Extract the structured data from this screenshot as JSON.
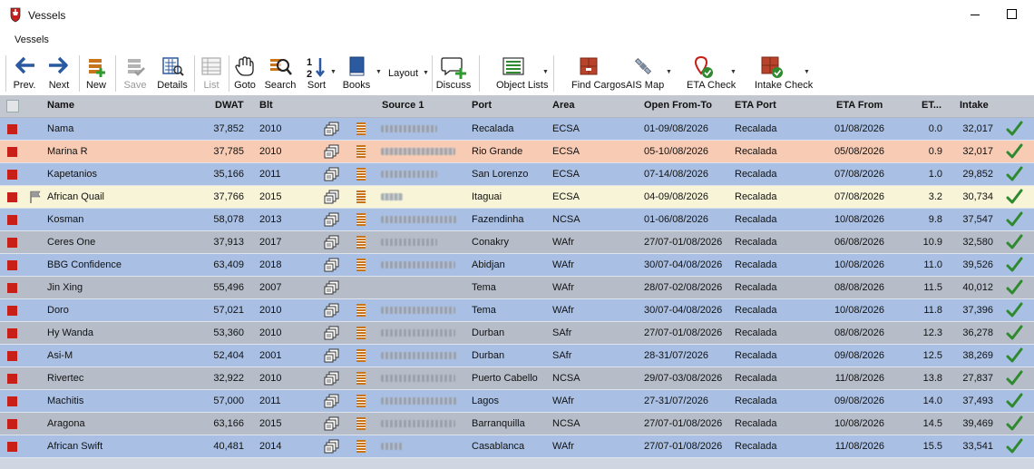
{
  "window": {
    "title": "Vessels"
  },
  "menu": {
    "vessels": "Vessels"
  },
  "toolbar": {
    "prev": "Prev.",
    "next": "Next",
    "new": "New",
    "save": "Save",
    "details": "Details",
    "list": "List",
    "goto": "Goto",
    "search": "Search",
    "sort": "Sort",
    "books": "Books",
    "layout": "Layout",
    "discuss": "Discuss",
    "object_lists": "Object Lists",
    "find_cargos": "Find Cargos",
    "ais_map": "AIS Map",
    "eta_check": "ETA Check",
    "intake_check": "Intake Check"
  },
  "columns": {
    "name": "Name",
    "dwat": "DWAT",
    "blt": "Blt",
    "source": "Source 1",
    "port": "Port",
    "area": "Area",
    "open": "Open From-To",
    "eta_port": "ETA Port",
    "eta_from": "ETA From",
    "et": "ET...",
    "intake": "Intake"
  },
  "colors": {
    "row_blue": "#a9c0e4",
    "row_grey": "#b6bdc9",
    "row_salmon": "#f7cbb4",
    "row_cream": "#f7f4d8",
    "status_red": "#c82018",
    "tick_green": "#2f8a2f",
    "book_orange": "#c8741c"
  },
  "rows": [
    {
      "name": "Nama",
      "dwat": "37,852",
      "blt": "2010",
      "port": "Recalada",
      "area": "ECSA",
      "open": "01-09/08/2026",
      "eta_port": "Recalada",
      "eta_from": "01/08/2026",
      "et": "0.0",
      "intake": "32,017",
      "bg": "#a9c0e4",
      "flag": false,
      "book": true,
      "src_w": 62
    },
    {
      "name": "Marina R",
      "dwat": "37,785",
      "blt": "2010",
      "port": "Rio Grande",
      "area": "ECSA",
      "open": "05-10/08/2026",
      "eta_port": "Recalada",
      "eta_from": "05/08/2026",
      "et": "0.9",
      "intake": "32,017",
      "bg": "#f7cbb4",
      "flag": false,
      "book": true,
      "src_w": 82
    },
    {
      "name": "Kapetanios",
      "dwat": "35,166",
      "blt": "2011",
      "port": "San Lorenzo",
      "area": "ECSA",
      "open": "07-14/08/2026",
      "eta_port": "Recalada",
      "eta_from": "07/08/2026",
      "et": "1.0",
      "intake": "29,852",
      "bg": "#a9c0e4",
      "flag": false,
      "book": true,
      "src_w": 62
    },
    {
      "name": "African Quail",
      "dwat": "37,766",
      "blt": "2015",
      "port": "Itaguai",
      "area": "ECSA",
      "open": "04-09/08/2026",
      "eta_port": "Recalada",
      "eta_from": "07/08/2026",
      "et": "3.2",
      "intake": "30,734",
      "bg": "#f7f4d8",
      "flag": true,
      "book": true,
      "src_w": 24
    },
    {
      "name": "Kosman",
      "dwat": "58,078",
      "blt": "2013",
      "port": "Fazendinha",
      "area": "NCSA",
      "open": "01-06/08/2026",
      "eta_port": "Recalada",
      "eta_from": "10/08/2026",
      "et": "9.8",
      "intake": "37,547",
      "bg": "#a9c0e4",
      "flag": false,
      "book": true,
      "src_w": 84
    },
    {
      "name": "Ceres One",
      "dwat": "37,913",
      "blt": "2017",
      "port": "Conakry",
      "area": "WAfr",
      "open": "27/07-01/08/2026",
      "eta_port": "Recalada",
      "eta_from": "06/08/2026",
      "et": "10.9",
      "intake": "32,580",
      "bg": "#b6bdc9",
      "flag": false,
      "book": true,
      "src_w": 62
    },
    {
      "name": "BBG Confidence",
      "dwat": "63,409",
      "blt": "2018",
      "port": "Abidjan",
      "area": "WAfr",
      "open": "30/07-04/08/2026",
      "eta_port": "Recalada",
      "eta_from": "10/08/2026",
      "et": "11.0",
      "intake": "39,526",
      "bg": "#a9c0e4",
      "flag": false,
      "book": true,
      "src_w": 82
    },
    {
      "name": "Jin Xing",
      "dwat": "55,496",
      "blt": "2007",
      "port": "Tema",
      "area": "WAfr",
      "open": "28/07-02/08/2026",
      "eta_port": "Recalada",
      "eta_from": "08/08/2026",
      "et": "11.5",
      "intake": "40,012",
      "bg": "#b6bdc9",
      "flag": false,
      "book": false,
      "src_w": 0
    },
    {
      "name": "Doro",
      "dwat": "57,021",
      "blt": "2010",
      "port": "Tema",
      "area": "WAfr",
      "open": "30/07-04/08/2026",
      "eta_port": "Recalada",
      "eta_from": "10/08/2026",
      "et": "11.8",
      "intake": "37,396",
      "bg": "#a9c0e4",
      "flag": false,
      "book": true,
      "src_w": 82
    },
    {
      "name": "Hy Wanda",
      "dwat": "53,360",
      "blt": "2010",
      "port": "Durban",
      "area": "SAfr",
      "open": "27/07-01/08/2026",
      "eta_port": "Recalada",
      "eta_from": "08/08/2026",
      "et": "12.3",
      "intake": "36,278",
      "bg": "#b6bdc9",
      "flag": false,
      "book": true,
      "src_w": 82
    },
    {
      "name": "Asi-M",
      "dwat": "52,404",
      "blt": "2001",
      "port": "Durban",
      "area": "SAfr",
      "open": "28-31/07/2026",
      "eta_port": "Recalada",
      "eta_from": "09/08/2026",
      "et": "12.5",
      "intake": "38,269",
      "bg": "#a9c0e4",
      "flag": false,
      "book": true,
      "src_w": 84
    },
    {
      "name": "Rivertec",
      "dwat": "32,922",
      "blt": "2010",
      "port": "Puerto Cabello",
      "area": "NCSA",
      "open": "29/07-03/08/2026",
      "eta_port": "Recalada",
      "eta_from": "11/08/2026",
      "et": "13.8",
      "intake": "27,837",
      "bg": "#b6bdc9",
      "flag": false,
      "book": true,
      "src_w": 82
    },
    {
      "name": "Machitis",
      "dwat": "57,000",
      "blt": "2011",
      "port": "Lagos",
      "area": "WAfr",
      "open": "27-31/07/2026",
      "eta_port": "Recalada",
      "eta_from": "09/08/2026",
      "et": "14.0",
      "intake": "37,493",
      "bg": "#a9c0e4",
      "flag": false,
      "book": true,
      "src_w": 84
    },
    {
      "name": "Aragona",
      "dwat": "63,166",
      "blt": "2015",
      "port": "Barranquilla",
      "area": "NCSA",
      "open": "27/07-01/08/2026",
      "eta_port": "Recalada",
      "eta_from": "10/08/2026",
      "et": "14.5",
      "intake": "39,469",
      "bg": "#b6bdc9",
      "flag": false,
      "book": true,
      "src_w": 82
    },
    {
      "name": "African Swift",
      "dwat": "40,481",
      "blt": "2014",
      "port": "Casablanca",
      "area": "WAfr",
      "open": "27/07-01/08/2026",
      "eta_port": "Recalada",
      "eta_from": "11/08/2026",
      "et": "15.5",
      "intake": "33,541",
      "bg": "#a9c0e4",
      "flag": false,
      "book": true,
      "src_w": 24
    }
  ]
}
